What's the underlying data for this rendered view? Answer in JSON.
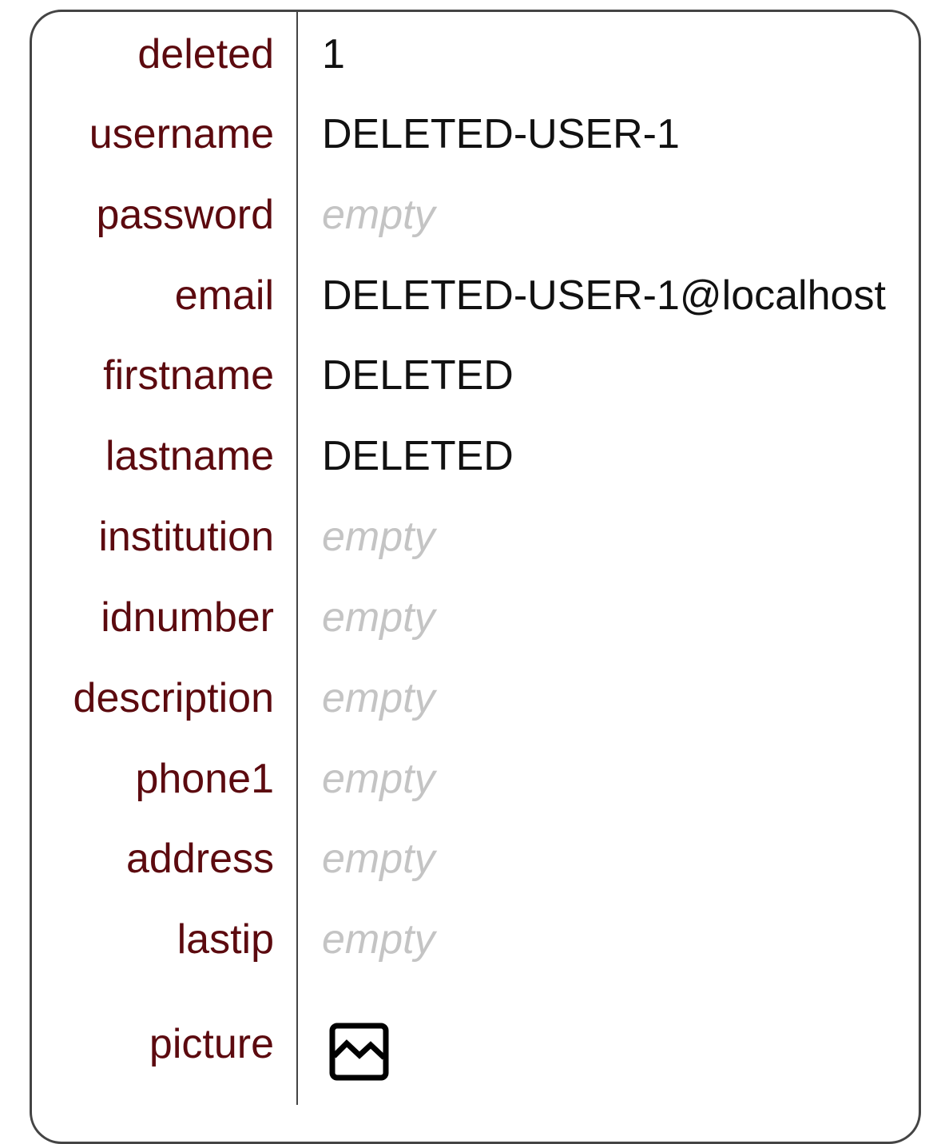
{
  "rows": [
    {
      "key": "deleted",
      "value": "1",
      "empty": false
    },
    {
      "key": "username",
      "value": "DELETED-USER-1",
      "empty": false
    },
    {
      "key": "password",
      "value": "empty",
      "empty": true
    },
    {
      "key": "email",
      "value": "DELETED-USER-1@localhost",
      "empty": false
    },
    {
      "key": "firstname",
      "value": "DELETED",
      "empty": false
    },
    {
      "key": "lastname",
      "value": "DELETED",
      "empty": false
    },
    {
      "key": "institution",
      "value": "empty",
      "empty": true
    },
    {
      "key": "idnumber",
      "value": "empty",
      "empty": true
    },
    {
      "key": "description",
      "value": "empty",
      "empty": true
    },
    {
      "key": "phone1",
      "value": "empty",
      "empty": true
    },
    {
      "key": "address",
      "value": "empty",
      "empty": true
    },
    {
      "key": "lastip",
      "value": "empty",
      "empty": true
    },
    {
      "key": "picture",
      "icon": "broken-image-icon"
    }
  ],
  "colors": {
    "key_text": "#5c0a0f",
    "value_text": "#111111",
    "empty_text": "#c4c4c4",
    "border": "#444444"
  }
}
